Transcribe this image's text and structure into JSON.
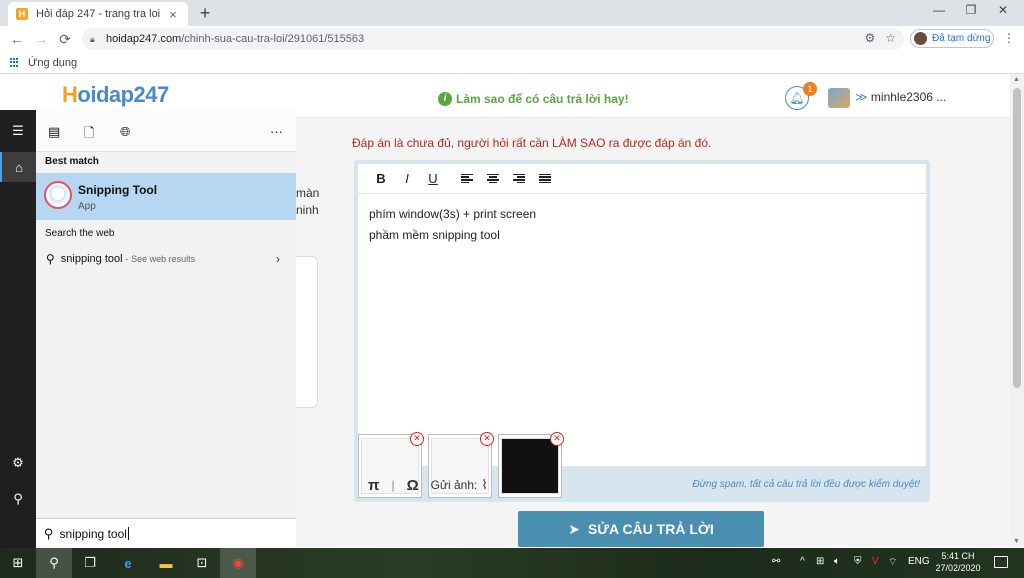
{
  "browser": {
    "tab_title": "Hỏi đáp 247 - trang tra loi",
    "tab_close": "×",
    "new_tab": "+",
    "window_controls": [
      "—",
      "❐",
      "✕"
    ],
    "url_host": "hoidap247.com",
    "url_path": "/chinh-sua-cau-tra-loi/291061/515563",
    "profile_label": "Đã tạm dừng",
    "bookmarks_label": "Ứng dụng"
  },
  "site": {
    "logo_h": "H",
    "logo_rest": "oidap247",
    "howto": "Làm sao để có câu trả lời hay!",
    "notification_count": "1",
    "username": "minhle2306 ...",
    "warning": "Đáp án là chưa đủ, người hỏi rất cần LÀM SAO ra được đáp án đó.",
    "left_partial_1": "màn",
    "left_partial_2": "ninh"
  },
  "editor": {
    "toolbar": [
      "B",
      "I",
      "U"
    ],
    "lines": [
      "phím window(3s) + print screen",
      "phầm mềm snipping tool"
    ],
    "footer_pi": "π",
    "footer_sep": "|",
    "footer_omega": "Ω",
    "footer_send": "Gửi ảnh:",
    "footer_hint": "Đừng spam, tất cả câu trả lời đều được kiểm duyệt!",
    "thumb_delete": "✕"
  },
  "submit_label": "SỬA CÂU TRẢ LỜI",
  "start_menu": {
    "more": "···",
    "best_match_header": "Best match",
    "best_match_name": "Snipping Tool",
    "best_match_type": "App",
    "web_header": "Search the web",
    "web_query": "snipping tool",
    "web_sub": "- See web results",
    "search_value": "snipping tool"
  },
  "taskbar": {
    "language": "ENG",
    "time": "5:41 CH",
    "date": "27/02/2020"
  },
  "colors": {
    "accent_blue": "#4a89c8",
    "logo_orange": "#f3a21f",
    "green": "#58a63f",
    "warning_red": "#b5271d",
    "submit_bg": "#4a8fb0",
    "best_match_bg": "#b6d6f1"
  },
  "icons": [
    "search-icon",
    "home-icon",
    "gear-icon",
    "bell-icon",
    "paperclip-icon",
    "paper-plane-icon",
    "chevron-right-icon"
  ]
}
